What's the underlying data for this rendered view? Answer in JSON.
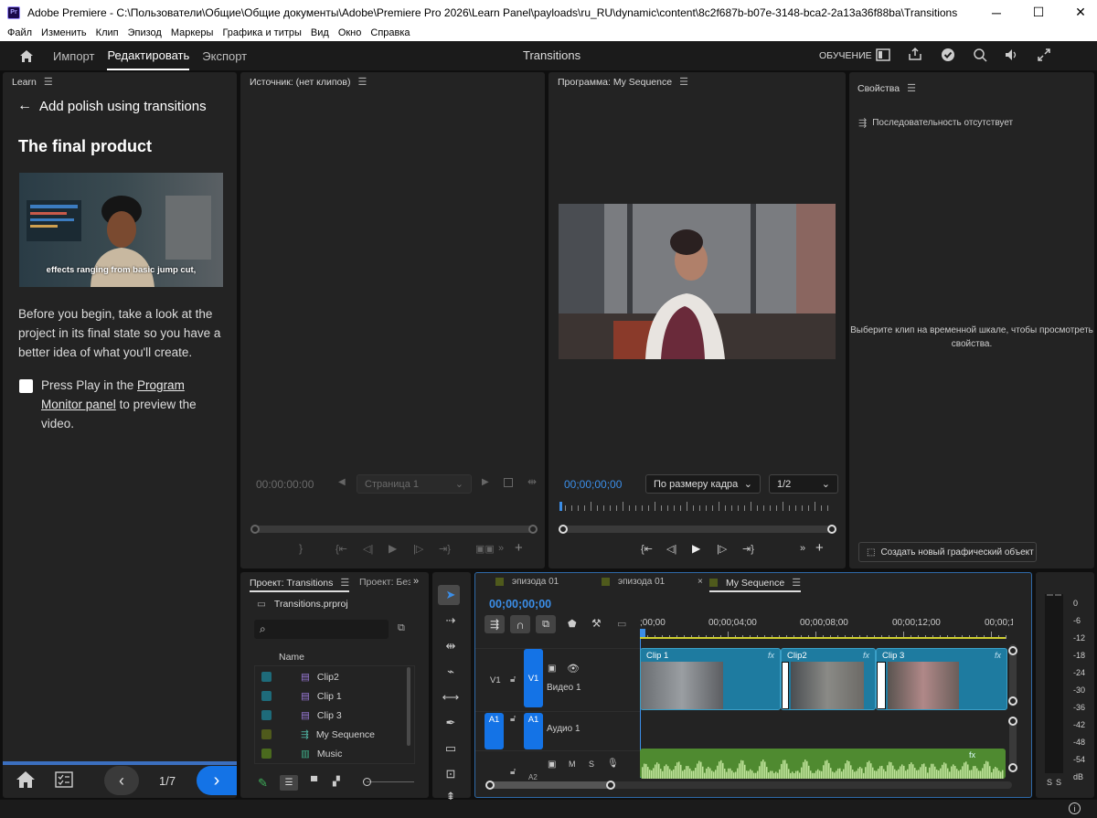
{
  "window": {
    "title": "Adobe Premiere - C:\\Пользователи\\Общие\\Общие документы\\Adobe\\Premiere Pro 2026\\Learn Panel\\payloads\\ru_RU\\dynamic\\content\\8c2f687b-b07e-3148-bca2-2a13a36f88ba\\Transitions",
    "app_badge": "Pr",
    "minimize": "─",
    "maximize": "☐",
    "close": "✕"
  },
  "menu": [
    "Файл",
    "Изменить",
    "Клип",
    "Эпизод",
    "Маркеры",
    "Графика и титры",
    "Вид",
    "Окно",
    "Справка"
  ],
  "header": {
    "home_icon": "home-icon",
    "tabs": [
      "Импорт",
      "Редактировать",
      "Экспорт"
    ],
    "active_tab": "Редактировать",
    "project_title": "Transitions",
    "learn_label": "ОБУЧЕНИЕ"
  },
  "learn": {
    "panel_title": "Learn",
    "back_label": "Add polish using transitions",
    "heading": "The final product",
    "video_caption": "effects ranging from basic jump cut,",
    "description": "Before you begin, take a look at the project in its final state so you have a better idea of what you'll create.",
    "task_prefix": "Press Play in the ",
    "task_link": "Program Monitor panel",
    "task_suffix": " to preview the video.",
    "page": "1/7"
  },
  "source": {
    "title": "Источник: (нет клипов)",
    "timecode": "00:00:00:00",
    "page_select": "Страница 1"
  },
  "program": {
    "title": "Программа: My Sequence",
    "timecode": "00;00;00;00",
    "fit": "По размеру кадра",
    "quality": "1/2"
  },
  "properties": {
    "title": "Свойства",
    "no_sequence": "Последовательность отсутствует",
    "hint": "Выберите клип на временной шкале, чтобы просмотреть свойства.",
    "new_graphic": "Создать новый графический объект"
  },
  "project": {
    "tab_active": "Проект: Transitions",
    "tab_other": "Проект: Без",
    "file": "Transitions.prproj",
    "column_name": "Name",
    "items": [
      {
        "name": "Clip2",
        "color": "#1e6b7a",
        "type": "clip"
      },
      {
        "name": "Clip 1",
        "color": "#1e6b7a",
        "type": "clip"
      },
      {
        "name": "Clip 3",
        "color": "#1e6b7a",
        "type": "clip"
      },
      {
        "name": "My Sequence",
        "color": "#4f5a1c",
        "type": "sequence"
      },
      {
        "name": "Music",
        "color": "#4a6a1e",
        "type": "audio"
      }
    ]
  },
  "timeline": {
    "tabs": [
      "эпизода 01",
      "эпизода 01",
      "My Sequence"
    ],
    "timecode": "00;00;00;00",
    "ruler": [
      ";00;00",
      "00;00;04;00",
      "00;00;08;00",
      "00;00;12;00",
      "00;00;1"
    ],
    "tracks": {
      "v1_label": "V1",
      "v1_target": "V1",
      "video_name": "Видео 1",
      "a1_label": "A1",
      "a1_target": "A1",
      "audio_name": "Аудио 1",
      "a2_label": "A2",
      "m_label": "M",
      "s_label": "S"
    },
    "clips": [
      {
        "name": "Clip 1",
        "fx": "fx"
      },
      {
        "name": "Clip2",
        "fx": "fx"
      },
      {
        "name": "Clip 3",
        "fx": "fx"
      }
    ]
  },
  "meters": {
    "labels": [
      "0",
      "-6",
      "-12",
      "-18",
      "-24",
      "-30",
      "-36",
      "-42",
      "-48",
      "-54",
      "dB"
    ],
    "solo": [
      "S",
      "S"
    ]
  }
}
